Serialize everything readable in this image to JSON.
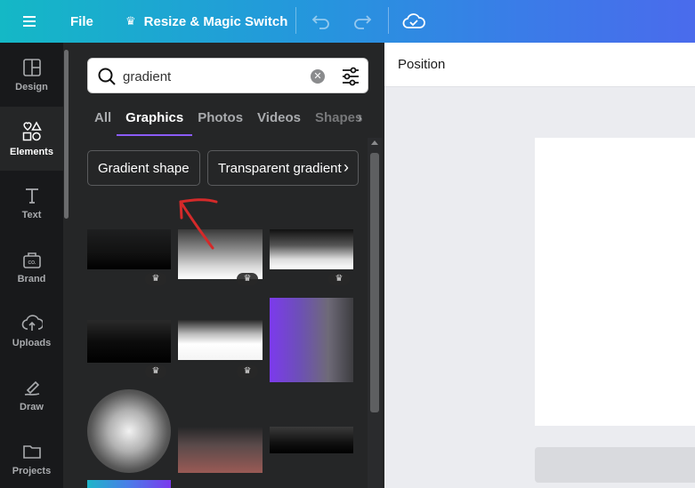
{
  "topbar": {
    "file_label": "File",
    "resize_label": "Resize & Magic Switch",
    "icons": [
      "menu-icon",
      "crown-icon",
      "undo-icon",
      "redo-icon",
      "cloud-saved-icon"
    ]
  },
  "rail": {
    "items": [
      {
        "label": "Design",
        "icon": "design-icon",
        "active": false
      },
      {
        "label": "Elements",
        "icon": "elements-icon",
        "active": true
      },
      {
        "label": "Text",
        "icon": "text-icon",
        "active": false
      },
      {
        "label": "Brand",
        "icon": "brand-icon",
        "active": false
      },
      {
        "label": "Uploads",
        "icon": "uploads-icon",
        "active": false
      },
      {
        "label": "Draw",
        "icon": "draw-icon",
        "active": false
      },
      {
        "label": "Projects",
        "icon": "projects-icon",
        "active": false
      }
    ]
  },
  "search": {
    "value": "gradient"
  },
  "tabs": [
    "All",
    "Graphics",
    "Photos",
    "Videos",
    "Shapes"
  ],
  "active_tab": "Graphics",
  "chips": [
    "Gradient shape",
    "Transparent gradient"
  ],
  "results": [
    {
      "kind": "black-fade-top",
      "premium": true
    },
    {
      "kind": "grey-fade",
      "premium": true
    },
    {
      "kind": "white-black-fade",
      "premium": true
    },
    {
      "kind": "black-fade",
      "premium": true
    },
    {
      "kind": "white-fade",
      "premium": true
    },
    {
      "kind": "purple-grey",
      "premium": false
    },
    {
      "kind": "radial-white",
      "premium": false
    },
    {
      "kind": "red-fade",
      "premium": false
    },
    {
      "kind": "black-bar",
      "premium": false
    },
    {
      "kind": "cyan-purple",
      "premium": false
    }
  ],
  "properties": {
    "position_label": "Position"
  },
  "colors": {
    "accent": "#8b5cf6",
    "annotation": "#d42a2a",
    "panel": "#252627",
    "rail": "#18191b"
  }
}
